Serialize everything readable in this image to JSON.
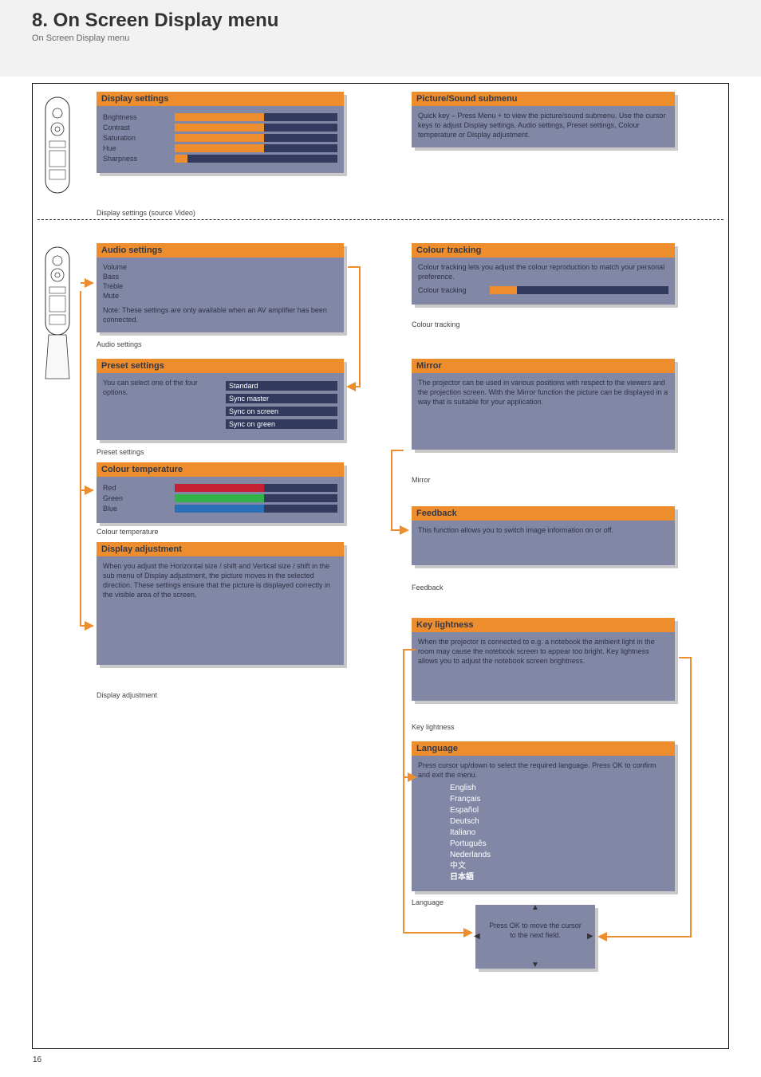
{
  "banner": {
    "title": "8. On Screen Display menu",
    "subtitle": "On Screen Display menu"
  },
  "left_col": {
    "display_settings": {
      "title": "Display settings",
      "rows": [
        {
          "label": "Brightness",
          "fill": 55
        },
        {
          "label": "Contrast",
          "fill": 55
        },
        {
          "label": "Saturation",
          "fill": 55
        },
        {
          "label": "Hue",
          "fill": 55
        },
        {
          "label": "Sharpness",
          "fill": 0
        }
      ],
      "caption": "Display settings (source Video)"
    },
    "audio_settings": {
      "title": "Audio settings",
      "rows": [
        {
          "label": "Volume"
        },
        {
          "label": "Bass"
        },
        {
          "label": "Treble"
        },
        {
          "label": "Mute"
        }
      ],
      "text": "Note: These settings are only available when an AV amplifier has been connected.",
      "caption": "Audio settings"
    },
    "preset_settings": {
      "title": "Preset settings",
      "options": [
        "Standard",
        "Sync master",
        "Sync on screen",
        "Sync on green"
      ],
      "text": "You can select one of the four options.",
      "caption": "Preset settings"
    },
    "colour_temp": {
      "title": "Colour temperature",
      "rows": [
        {
          "label": "Red",
          "class": "red",
          "fill": 55
        },
        {
          "label": "Green",
          "class": "green",
          "fill": 55
        },
        {
          "label": "Blue",
          "class": "blue",
          "fill": 55
        }
      ],
      "caption": "Colour temperature"
    },
    "display_adjust": {
      "title": "Display adjustment",
      "text": "When you adjust the Horizontal size / shift and Vertical size / shift in the sub menu of Display adjustment, the picture moves in the selected direction. These settings ensure that the picture is displayed correctly in the visible area of the screen.",
      "caption": "Display adjustment"
    }
  },
  "right_col": {
    "box1": {
      "title": "Picture/Sound submenu",
      "text": "Quick key – Press Menu + to view the picture/sound submenu. Use the cursor keys to adjust Display settings, Audio settings, Preset settings, Colour temperature or Display adjustment."
    },
    "colour_tracking": {
      "title": "Colour tracking",
      "row_label": "Colour tracking",
      "text": "Colour tracking lets you adjust the colour reproduction to match your personal preference.",
      "caption": "Colour tracking"
    },
    "mirror": {
      "title": "Mirror",
      "text": "The projector can be used in various positions with respect to the viewers and the projection screen. With the Mirror function the picture can be displayed in a way that is suitable for your application.",
      "caption": "Mirror"
    },
    "feedback": {
      "title": "Feedback",
      "text": "This function allows you to switch image information on or off.",
      "caption": "Feedback"
    },
    "key_lightness": {
      "title": "Key lightness",
      "text": "When the projector is connected to e.g. a notebook the ambient light in the room may cause the notebook screen to appear too bright. Key lightness allows you to adjust the notebook screen brightness.",
      "caption": "Key lightness"
    },
    "language": {
      "title": "Language",
      "text": "Press cursor up/down to select the required language. Press OK to confirm and exit the menu.",
      "options": [
        "English",
        "Français",
        "Español",
        "Deutsch",
        "Italiano",
        "Português",
        "Nederlands",
        "中文",
        "日本語"
      ],
      "caption": "Language"
    },
    "nav_box": {
      "labels": {
        "up": "▲",
        "down": "▼",
        "left": "◀",
        "right": "▶"
      },
      "text": "Press OK to move the cursor to the next field."
    }
  },
  "page_number": "16"
}
